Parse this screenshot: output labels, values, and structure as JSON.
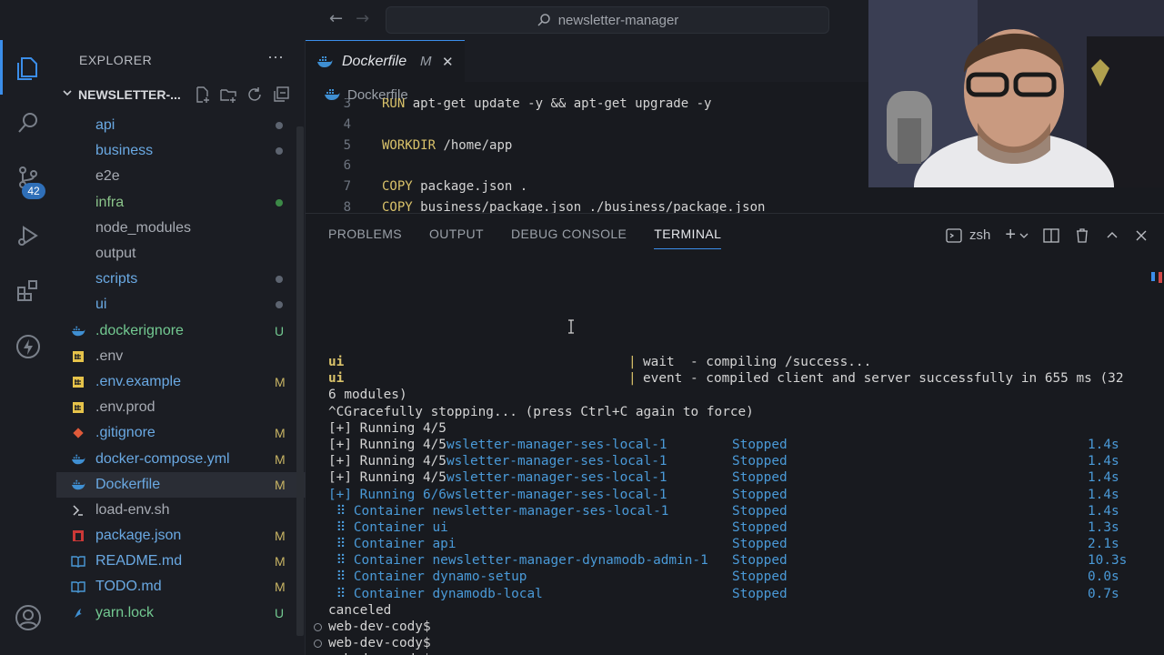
{
  "titlebar": {
    "back": "←",
    "forward": "→",
    "search_text": "newsletter-manager"
  },
  "activity": {
    "scm_badge": "42"
  },
  "sidebar": {
    "header": "EXPLORER",
    "more": "···",
    "folder": "NEWSLETTER-...",
    "items": [
      {
        "label": "api",
        "type": "folder",
        "status": "dot",
        "status_color": "#5d6470"
      },
      {
        "label": "business",
        "type": "folder",
        "status": "dot",
        "status_color": "#5d6470"
      },
      {
        "label": "e2e",
        "type": "folder",
        "status": "",
        "status_color": ""
      },
      {
        "label": "infra",
        "type": "folder",
        "status": "dot",
        "status_color": "#3c8a47"
      },
      {
        "label": "node_modules",
        "type": "folder",
        "status": "",
        "status_color": ""
      },
      {
        "label": "output",
        "type": "folder",
        "status": "",
        "status_color": ""
      },
      {
        "label": "scripts",
        "type": "folder",
        "status": "dot",
        "status_color": "#5d6470"
      },
      {
        "label": "ui",
        "type": "folder",
        "status": "dot",
        "status_color": "#5d6470"
      },
      {
        "label": ".dockerignore",
        "type": "docker",
        "status": "U",
        "status_color": "#73c991"
      },
      {
        "label": ".env",
        "type": "env",
        "status": "",
        "status_color": ""
      },
      {
        "label": ".env.example",
        "type": "env",
        "status": "M",
        "status_color": "#c8b464"
      },
      {
        "label": ".env.prod",
        "type": "env",
        "status": "",
        "status_color": ""
      },
      {
        "label": ".gitignore",
        "type": "git",
        "status": "M",
        "status_color": "#c8b464"
      },
      {
        "label": "docker-compose.yml",
        "type": "docker",
        "status": "M",
        "status_color": "#c8b464"
      },
      {
        "label": "Dockerfile",
        "type": "docker",
        "status": "M",
        "status_color": "#c8b464"
      },
      {
        "label": "load-env.sh",
        "type": "shell",
        "status": "",
        "status_color": ""
      },
      {
        "label": "package.json",
        "type": "npm",
        "status": "M",
        "status_color": "#c8b464"
      },
      {
        "label": "README.md",
        "type": "md",
        "status": "M",
        "status_color": "#c8b464"
      },
      {
        "label": "TODO.md",
        "type": "md",
        "status": "M",
        "status_color": "#c8b464"
      },
      {
        "label": "yarn.lock",
        "type": "yarn",
        "status": "U",
        "status_color": "#73c991"
      }
    ]
  },
  "editor": {
    "tab_label": "Dockerfile",
    "tab_modified": "M",
    "tab_close": "✕",
    "breadcrumb": "Dockerfile",
    "lines": [
      {
        "n": "3",
        "kw": "RUN",
        "rest": " apt-get update -y && apt-get upgrade -y"
      },
      {
        "n": "4",
        "kw": "",
        "rest": ""
      },
      {
        "n": "5",
        "kw": "WORKDIR",
        "rest": " /home/app"
      },
      {
        "n": "6",
        "kw": "",
        "rest": ""
      },
      {
        "n": "7",
        "kw": "COPY",
        "rest": " package.json ."
      },
      {
        "n": "8",
        "kw": "COPY",
        "rest": " business/package.json ./business/package.json"
      }
    ]
  },
  "panel": {
    "tabs": [
      "PROBLEMS",
      "OUTPUT",
      "DEBUG CONSOLE",
      "TERMINAL"
    ],
    "shell_name": "zsh",
    "add": "+",
    "terminal": {
      "ui_line1_prefix": "ui",
      "ui_line1_msg": "wait  - compiling /success...",
      "ui_line2_prefix": "ui",
      "ui_line2_msg": "event - compiled client and server successfully in 655 ms (32",
      "wrap_line": "6 modules)",
      "ctrlc_line": "^CGracefully stopping... (press Ctrl+C again to force)",
      "running_1": "[+] Running 4/5",
      "running_rows": [
        {
          "prefix": "[+] Running 4/5",
          "name": "wsletter-manager-ses-local-1",
          "status": "Stopped",
          "time": "1.4s"
        },
        {
          "prefix": "[+] Running 4/5",
          "name": "wsletter-manager-ses-local-1",
          "status": "Stopped",
          "time": "1.4s"
        },
        {
          "prefix": "[+] Running 4/5",
          "name": "wsletter-manager-ses-local-1",
          "status": "Stopped",
          "time": "1.4s"
        },
        {
          "prefix": "[+] Running 6/6",
          "name": "wsletter-manager-ses-local-1",
          "status": "Stopped",
          "time": "1.4s"
        }
      ],
      "containers": [
        {
          "name": " ⠿ Container newsletter-manager-ses-local-1",
          "status": "Stopped",
          "time": "1.4s"
        },
        {
          "name": " ⠿ Container ui",
          "status": "Stopped",
          "time": "1.3s"
        },
        {
          "name": " ⠿ Container api",
          "status": "Stopped",
          "time": "2.1s"
        },
        {
          "name": " ⠿ Container newsletter-manager-dynamodb-admin-1",
          "status": "Stopped",
          "time": "10.3s"
        },
        {
          "name": " ⠿ Container dynamo-setup",
          "status": "Stopped",
          "time": "0.0s"
        },
        {
          "name": " ⠿ Container dynamodb-local",
          "status": "Stopped",
          "time": "0.7s"
        }
      ],
      "canceled": "canceled",
      "prompt1": "web-dev-cody$",
      "prompt2": "web-dev-cody$",
      "prompt3": "web-dev-cody$"
    }
  },
  "colors": {
    "accent": "#3b8eea",
    "keyword": "#d9c26a",
    "terminal_blue": "#4a9ad8"
  }
}
